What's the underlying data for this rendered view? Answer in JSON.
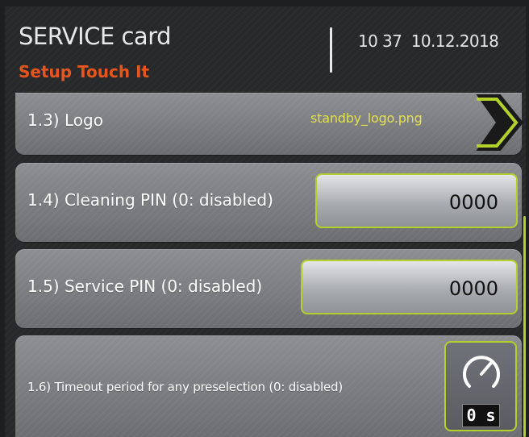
{
  "header": {
    "title": "SERVICE card",
    "subtitle": "Setup Touch It",
    "time": "10 37",
    "date": "10.12.2018"
  },
  "rows": [
    {
      "label": "1.3) Logo",
      "value": "standby_logo.png"
    },
    {
      "label": "1.4) Cleaning PIN (0: disabled)",
      "value": "0000"
    },
    {
      "label": "1.5) Service PIN (0: disabled)",
      "value": "0000"
    },
    {
      "label": "1.6) Timeout period for any preselection (0: disabled)",
      "value": "0 s"
    }
  ],
  "colors": {
    "accent": "#b3d12c",
    "subtitle": "#e8541e",
    "filename": "#e3e14a"
  },
  "icons": {
    "logo_row": "chevron-right-icon",
    "timeout_row": "gauge-icon"
  }
}
